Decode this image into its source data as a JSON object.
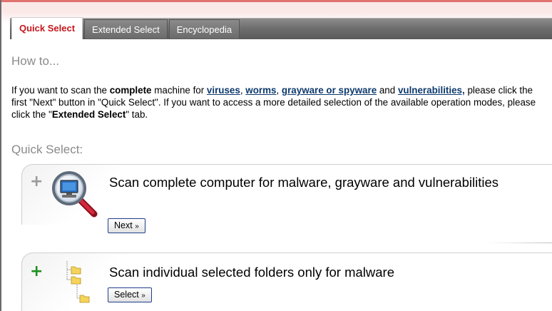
{
  "tabs": [
    {
      "label": "Quick Select",
      "active": true
    },
    {
      "label": "Extended Select",
      "active": false
    },
    {
      "label": "Encyclopedia",
      "active": false
    }
  ],
  "howto_heading": "How to...",
  "intro": {
    "part1": "If you want to scan the ",
    "complete": "complete",
    "part2": " machine for ",
    "link_viruses": "viruses",
    "comma1": ", ",
    "link_worms": "worms",
    "comma2": ", ",
    "link_grayware": "grayware or spyware",
    "and": " and ",
    "link_vulnerabilities": "vulnerabilities,",
    "part3": " please click the first \"Next\" button in \"Quick Select\". If you want to access a more detailed selection of the available operation modes, please click the \"",
    "extended_select": "Extended Select",
    "part4": "\" tab."
  },
  "quick_select_heading": "Quick Select:",
  "options": [
    {
      "title": "Scan complete computer for malware, grayware and vulnerabilities",
      "button_label": "Next",
      "button_arrow": "»",
      "icon": "magnifier-computer-icon"
    },
    {
      "title": "Scan individual selected folders only for malware",
      "button_label": "Select",
      "button_arrow": "»",
      "icon": "folder-tree-icon"
    }
  ],
  "colors": {
    "active_tab_text": "#c4171c",
    "link": "#0e3a6e",
    "heading_grey": "#8a8a8a",
    "plus_green": "#1e8f1e"
  }
}
